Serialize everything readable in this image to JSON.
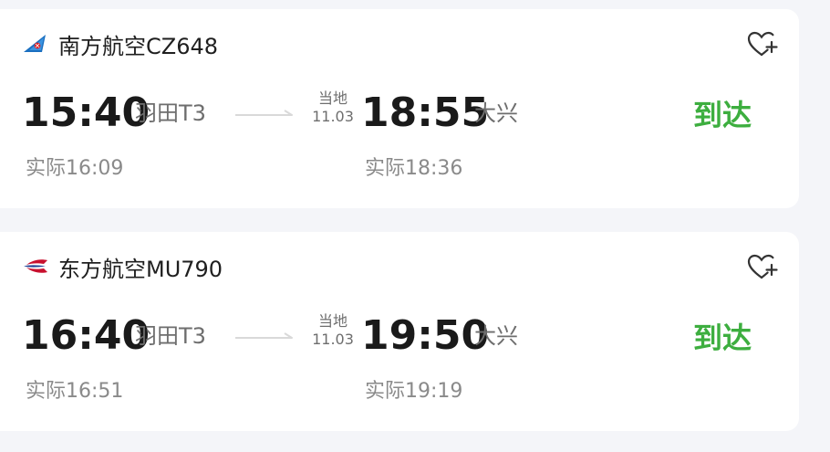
{
  "flights": [
    {
      "airline": "南方航空CZ648",
      "airline_icon": "china-southern-logo-icon",
      "dep_time": "15:40",
      "dep_terminal": "羽田T3",
      "local_label": "当地",
      "arr_date": "11.03",
      "arr_time": "18:55",
      "arr_airport": "大兴",
      "status": "到达",
      "actual_dep": "实际16:09",
      "actual_arr": "实际18:36"
    },
    {
      "airline": "东方航空MU790",
      "airline_icon": "china-eastern-logo-icon",
      "dep_time": "16:40",
      "dep_terminal": "羽田T3",
      "local_label": "当地",
      "arr_date": "11.03",
      "arr_time": "19:50",
      "arr_airport": "大兴",
      "status": "到达",
      "actual_dep": "实际16:51",
      "actual_arr": "实际19:19"
    }
  ],
  "colors": {
    "status_green": "#3dae3f",
    "page_bg": "#f4f5f9",
    "card_bg": "#ffffff"
  }
}
